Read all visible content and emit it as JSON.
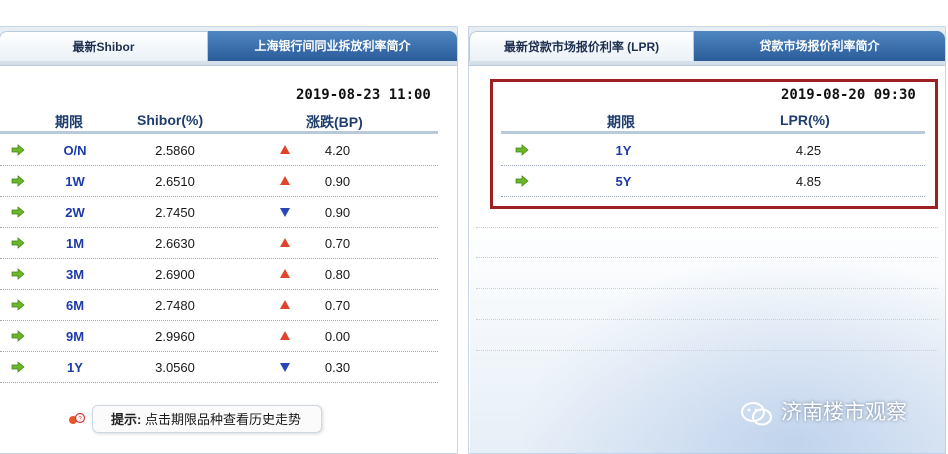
{
  "shibor": {
    "tab_active": "最新Shibor",
    "tab_inactive": "上海银行间同业拆放利率简介",
    "datetime": "2019-08-23 11:00",
    "headers": {
      "term": "期限",
      "rate": "Shibor(%)",
      "change": "涨跌(BP)"
    },
    "rows": [
      {
        "term": "O/N",
        "rate": "2.5860",
        "direction": "up",
        "change": "4.20"
      },
      {
        "term": "1W",
        "rate": "2.6510",
        "direction": "up",
        "change": "0.90"
      },
      {
        "term": "2W",
        "rate": "2.7450",
        "direction": "down",
        "change": "0.90"
      },
      {
        "term": "1M",
        "rate": "2.6630",
        "direction": "up",
        "change": "0.70"
      },
      {
        "term": "3M",
        "rate": "2.6900",
        "direction": "up",
        "change": "0.80"
      },
      {
        "term": "6M",
        "rate": "2.7480",
        "direction": "up",
        "change": "0.70"
      },
      {
        "term": "9M",
        "rate": "2.9960",
        "direction": "up",
        "change": "0.00"
      },
      {
        "term": "1Y",
        "rate": "3.0560",
        "direction": "down",
        "change": "0.30"
      }
    ],
    "hint_prefix": "提示:",
    "hint_text": "点击期限品种查看历史走势"
  },
  "lpr": {
    "tab_active": "最新贷款市场报价利率 (LPR)",
    "tab_inactive": "贷款市场报价利率简介",
    "datetime": "2019-08-20 09:30",
    "headers": {
      "term": "期限",
      "rate": "LPR(%)"
    },
    "rows": [
      {
        "term": "1Y",
        "rate": "4.25"
      },
      {
        "term": "5Y",
        "rate": "4.85"
      }
    ]
  },
  "watermark": {
    "text": "济南楼市观察"
  },
  "colors": {
    "up": "#e0442a",
    "down": "#2746b5",
    "arrow": "#6cb82a",
    "highlight": "#9e1f1f"
  }
}
